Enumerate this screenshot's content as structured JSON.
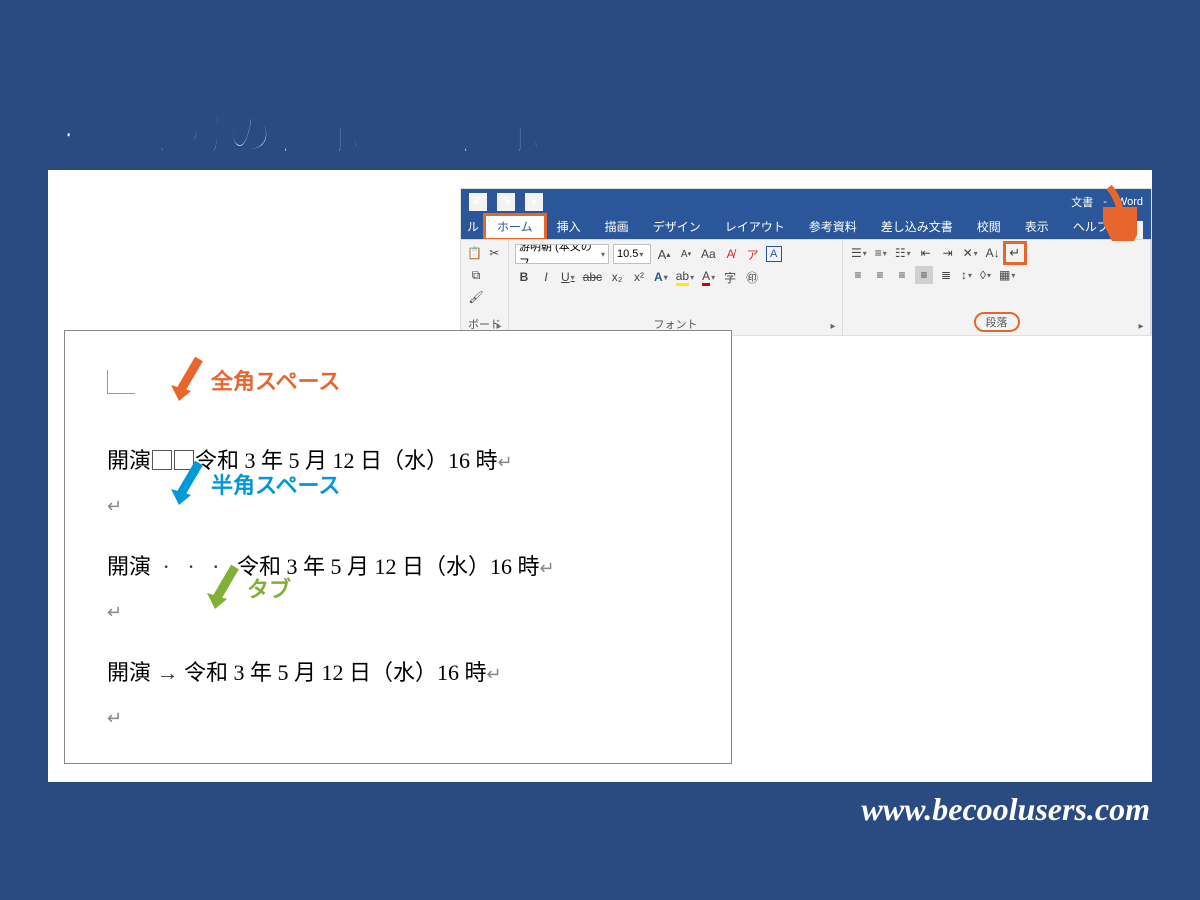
{
  "page_title": "編集記号の表示／非表示",
  "footer_url": "www.becoolusers.com",
  "titlebar": {
    "doc_label": "文書",
    "app_label": "Word"
  },
  "tabs": {
    "file_fragment": "ル",
    "home": "ホーム",
    "insert": "挿入",
    "draw": "描画",
    "design": "デザイン",
    "layout": "レイアウト",
    "references": "参考資料",
    "mailings": "差し込み文書",
    "review": "校閲",
    "view": "表示",
    "help": "ヘルプ"
  },
  "ribbon": {
    "clipboard_fragment": "ボード",
    "font_name": "游明朝 (本文のフ",
    "font_size": "10.5",
    "group_font": "フォント",
    "group_paragraph": "段落",
    "btn_B": "B",
    "btn_I": "I",
    "btn_U": "U",
    "btn_abc": "abc",
    "btn_x2": "x₂",
    "btn_x2sup": "x²",
    "btn_Aa": "Aa",
    "btn_A_big": "A",
    "btn_A_small": "A",
    "btn_ruby": "ア",
    "btn_border_A": "A",
    "btn_clear": "A",
    "btn_highlight": "ab",
    "btn_fontcolor": "A",
    "btn_charframe": "字",
    "btn_enclose": "㊞"
  },
  "annotations": {
    "fullwidth_space": "全角スペース",
    "halfwidth_space": "半角スペース",
    "tab": "タブ"
  },
  "document": {
    "line1_prefix": "開演",
    "line1_rest": "令和 3 年 5 月 12 日（水）16 時",
    "line2_prefix": "開演",
    "line2_rest": "令和 3 年 5 月 12 日（水）16 時",
    "line3_prefix": "開演",
    "line3_rest": "令和 3 年 5 月 12 日（水）16 時"
  }
}
